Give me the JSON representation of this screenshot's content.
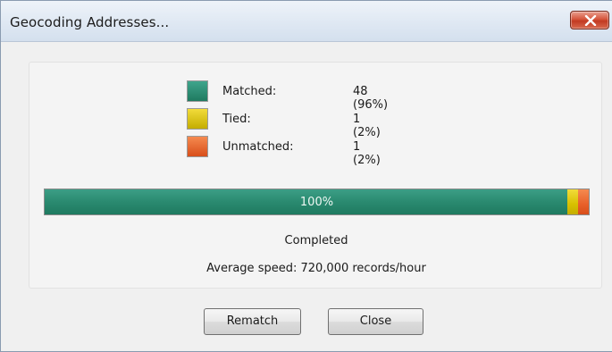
{
  "window": {
    "title": "Geocoding Addresses...",
    "close_icon": "close-x-icon"
  },
  "legend": [
    {
      "label": "Matched:",
      "value": "48 (96%)",
      "color": "#2a8a70"
    },
    {
      "label": "Tied:",
      "value": "1 (2%)",
      "color": "#d8c000"
    },
    {
      "label": "Unmatched:",
      "value": "1 (2%)",
      "color": "#e8602a"
    }
  ],
  "progress": {
    "label": "100%",
    "matched_fraction": 0.96,
    "tied_fraction": 0.02,
    "unmatched_fraction": 0.02
  },
  "status": {
    "state": "Completed",
    "speed": "Average speed: 720,000 records/hour"
  },
  "buttons": {
    "rematch": "Rematch",
    "close": "Close"
  }
}
